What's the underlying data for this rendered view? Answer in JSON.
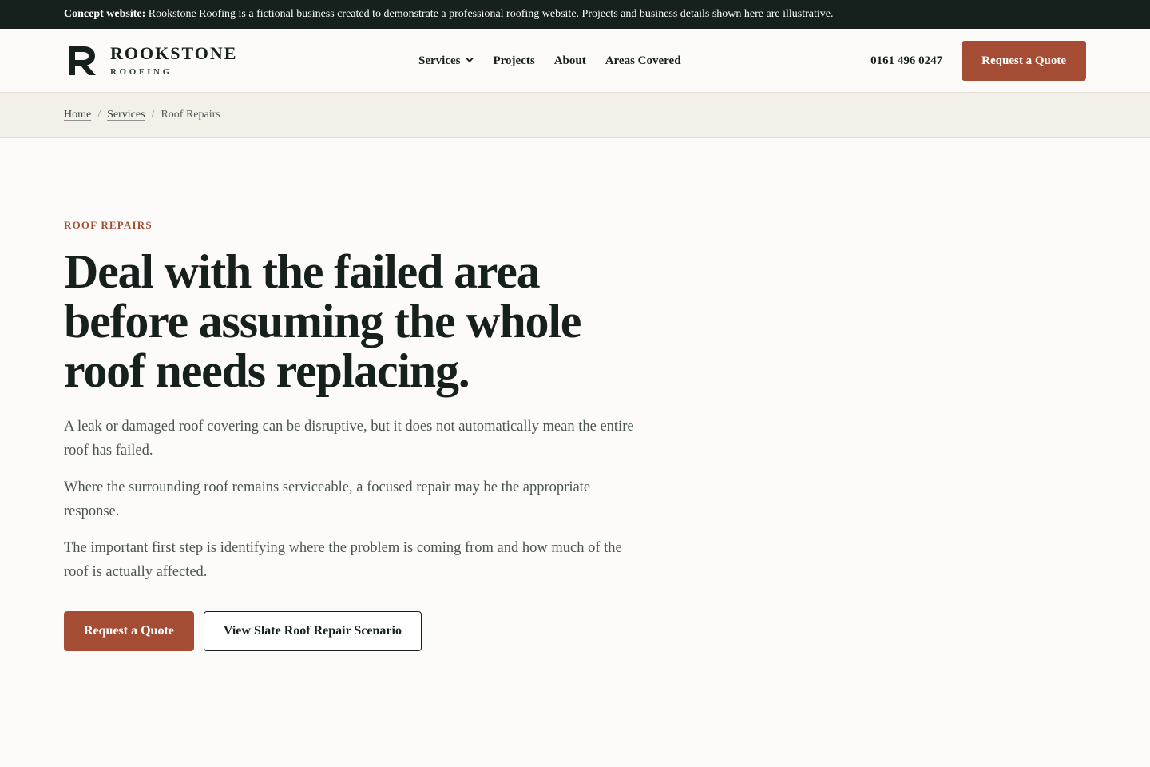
{
  "banner": {
    "label": "Concept website:",
    "text": " Rookstone Roofing is a fictional business created to demonstrate a professional roofing website. Projects and business details shown here are illustrative."
  },
  "header": {
    "logo": {
      "mark_icon": "rookstone-r-logo-icon",
      "name": "ROOKSTONE",
      "sub": "ROOFING"
    },
    "nav": [
      {
        "label": "Services",
        "has_dropdown": true,
        "icon": "chevron-down-icon"
      },
      {
        "label": "Projects"
      },
      {
        "label": "About"
      },
      {
        "label": "Areas Covered"
      }
    ],
    "phone": "0161 496 0247",
    "cta_label": "Request a Quote"
  },
  "breadcrumb": {
    "items": [
      "Home",
      "Services"
    ],
    "separator": "/",
    "current": "Roof Repairs"
  },
  "hero": {
    "eyebrow": "ROOF REPAIRS",
    "headline": "Deal with the failed area before assuming the whole roof needs replacing.",
    "paragraphs": [
      "A leak or damaged roof covering can be disruptive, but it does not automatically mean the entire roof has failed.",
      "Where the surrounding roof remains serviceable, a focused repair may be the appropriate response.",
      "The important first step is identifying where the problem is coming from and how much of the roof is actually affected."
    ],
    "primary_cta": "Request a Quote",
    "secondary_cta": "View Slate Roof Repair Scenario"
  },
  "colors": {
    "dark": "#16211d",
    "accent": "#a44d34",
    "background": "#fcfbf9",
    "breadcrumb_bg": "#f3f0ea",
    "body_text": "#4b5551"
  }
}
